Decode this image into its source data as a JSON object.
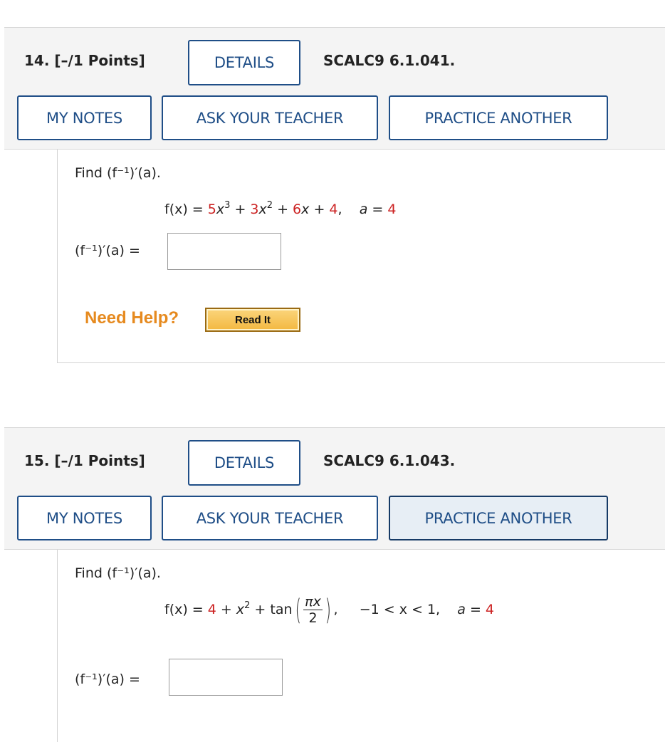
{
  "questions": [
    {
      "title": "14.  [–/1 Points]",
      "details_label": "DETAILS",
      "reference": "SCALC9 6.1.041.",
      "my_notes_label": "MY NOTES",
      "ask_teacher_label": "ASK YOUR TEACHER",
      "practice_label": "PRACTICE ANOTHER",
      "find_text": "Find (f⁻¹)′(a).",
      "equation": {
        "lhs": "f(x)",
        "parts": [
          "5",
          "x",
          "3",
          "+",
          "3",
          "x",
          "2",
          "+",
          "6",
          "x",
          "+",
          "4",
          "a",
          "4"
        ]
      },
      "answer_label": "(f⁻¹)′(a) =",
      "answer_value": "",
      "need_help_label": "Need Help?",
      "read_it_label": "Read It"
    },
    {
      "title": "15.  [–/1 Points]",
      "details_label": "DETAILS",
      "reference": "SCALC9 6.1.043.",
      "my_notes_label": "MY NOTES",
      "ask_teacher_label": "ASK YOUR TEACHER",
      "practice_label": "PRACTICE ANOTHER",
      "find_text": "Find (f⁻¹)′(a).",
      "equation": {
        "lhs": "f(x)",
        "const": "4",
        "tan": "tan",
        "frac_num": "πx",
        "frac_den": "2",
        "domain": "−1 < x < 1,",
        "a_value": "4"
      },
      "answer_label": "(f⁻¹)′(a) =",
      "answer_value": ""
    }
  ],
  "colors": {
    "button_border": "#1f4e87",
    "highlight_red": "#cc2222",
    "need_help_orange": "#e68a1f"
  }
}
